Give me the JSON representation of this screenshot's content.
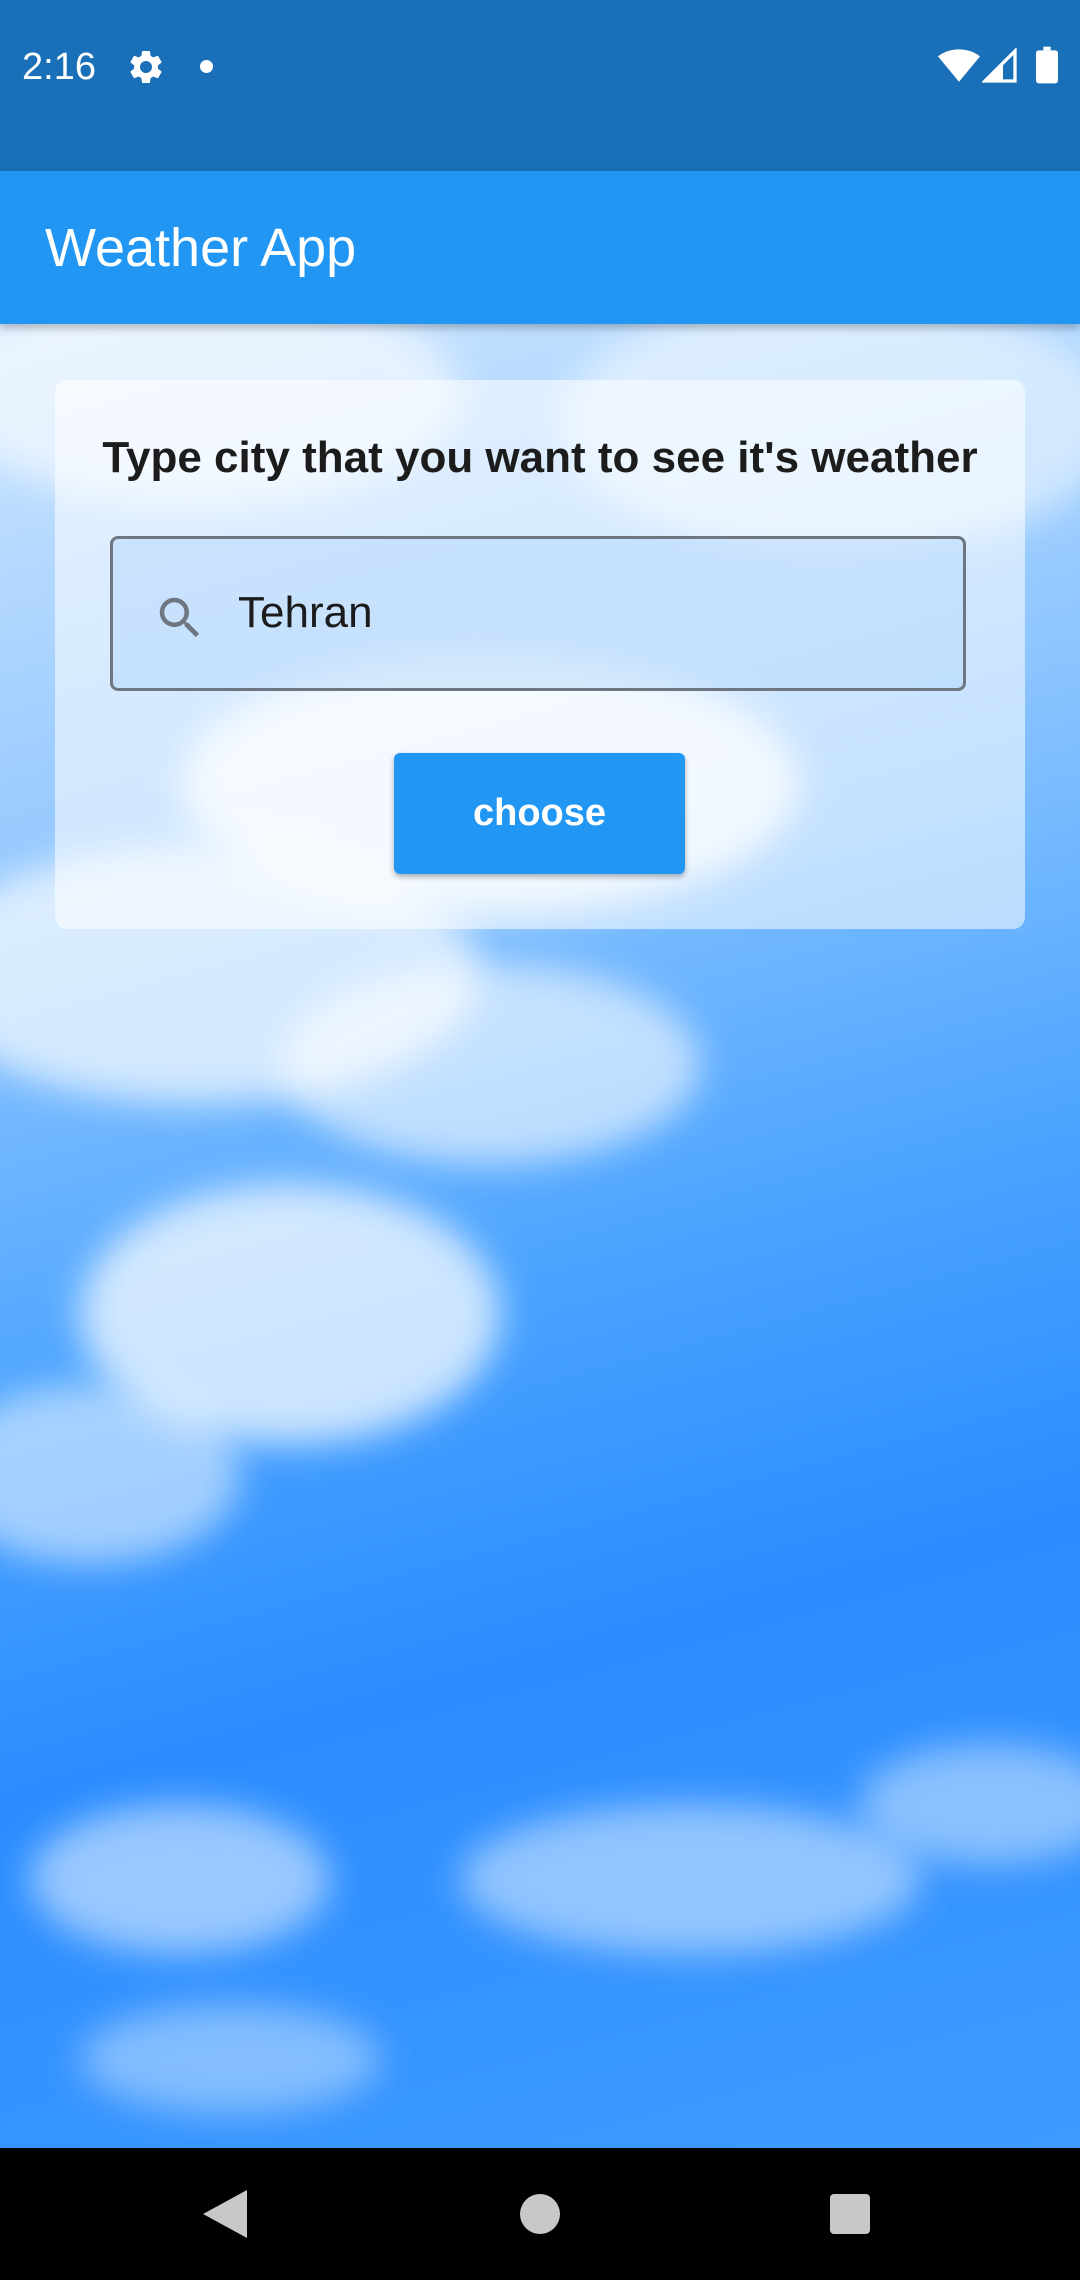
{
  "status_bar": {
    "time": "2:16",
    "icons": [
      "gear-icon",
      "notification-dot-icon",
      "wifi-icon",
      "signal-icon",
      "battery-icon"
    ]
  },
  "app_bar": {
    "title": "Weather App",
    "color": "#2196f3"
  },
  "card": {
    "heading": "Type city that you want to see it's weather",
    "search": {
      "icon": "search-icon",
      "value": "Tehran"
    },
    "button_label": "choose"
  },
  "nav_bar": {
    "icons": [
      "back-icon",
      "home-icon",
      "recents-icon"
    ]
  },
  "colors": {
    "status_bar": "#1a70b8",
    "accent": "#2196f3"
  }
}
